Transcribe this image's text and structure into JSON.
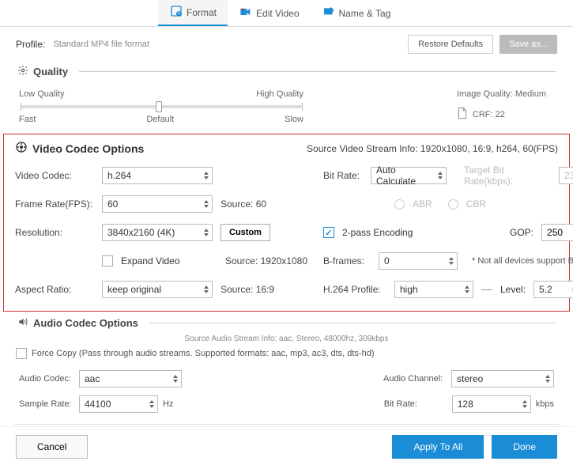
{
  "tabs": {
    "format": "Format",
    "edit": "Edit Video",
    "name": "Name & Tag"
  },
  "profile": {
    "label": "Profile:",
    "value": "Standard MP4 file format",
    "restore": "Restore Defaults",
    "saveas": "Save as..."
  },
  "quality": {
    "title": "Quality",
    "low": "Low Quality",
    "high": "High Quality",
    "fast": "Fast",
    "default": "Default",
    "slow": "Slow",
    "imgq": "Image Quality: Medium",
    "crf": "CRF: 22"
  },
  "video": {
    "title": "Video Codec Options",
    "source_info": "Source Video Stream Info: 1920x1080, 16:9, h264, 60(FPS)",
    "codec_lbl": "Video Codec:",
    "codec_val": "h.264",
    "bitrate_lbl": "Bit Rate:",
    "bitrate_val": "Auto Calculate",
    "target_lbl": "Target Bit Rate(kbps):",
    "target_val": "23",
    "fps_lbl": "Frame Rate(FPS):",
    "fps_val": "60",
    "fps_src": "Source: 60",
    "abr": "ABR",
    "cbr": "CBR",
    "res_lbl": "Resolution:",
    "res_val": "3840x2160 (4K)",
    "custom": "Custom",
    "res_src": "Source: 1920x1080",
    "expand": "Expand Video",
    "twopass": "2-pass Encoding",
    "gop_lbl": "GOP:",
    "gop_val": "250",
    "bframes_lbl": "B-frames:",
    "bframes_val": "0",
    "bframes_note": "* Not all devices support B",
    "aspect_lbl": "Aspect Ratio:",
    "aspect_val": "keep original",
    "aspect_src": "Source: 16:9",
    "profile_lbl": "H.264 Profile:",
    "profile_val": "high",
    "level_lbl": "Level:",
    "level_val": "5.2"
  },
  "audio": {
    "title": "Audio Codec Options",
    "source_info": "Source Audio Stream Info: aac, Stereo, 48000hz, 309kbps",
    "forcecopy": "Force Copy (Pass through audio streams. Supported formats: aac, mp3, ac3, dts, dts-hd)",
    "codec_lbl": "Audio Codec:",
    "codec_val": "aac",
    "channel_lbl": "Audio Channel:",
    "channel_val": "stereo",
    "sample_lbl": "Sample Rate:",
    "sample_val": "44100",
    "hz": "Hz",
    "bitrate_lbl": "Bit Rate:",
    "bitrate_val": "128",
    "kbps": "kbps"
  },
  "footer": {
    "cancel": "Cancel",
    "apply": "Apply To All",
    "done": "Done"
  }
}
